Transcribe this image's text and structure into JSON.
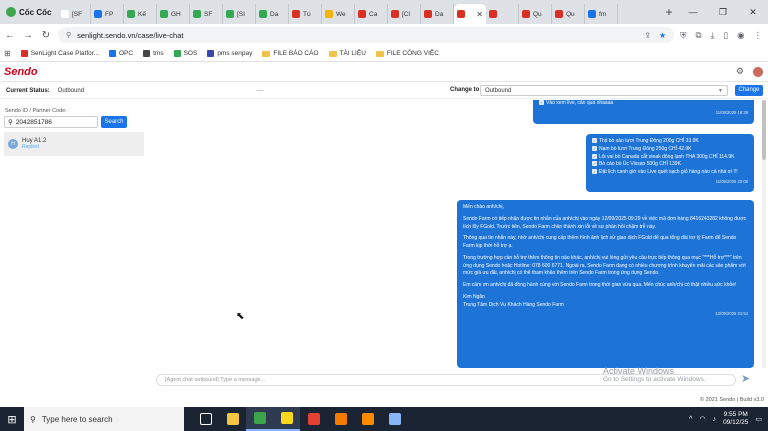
{
  "browser": {
    "brand": "Cốc Cốc",
    "tabs": [
      {
        "label": "[SF",
        "color": "#ffffff"
      },
      {
        "label": "FP",
        "color": "#1a73e8"
      },
      {
        "label": "Kế",
        "color": "#34a853"
      },
      {
        "label": "GH",
        "color": "#34a853"
      },
      {
        "label": "SF",
        "color": "#34a853"
      },
      {
        "label": "[SI",
        "color": "#34a853"
      },
      {
        "label": "Da",
        "color": "#34a853"
      },
      {
        "label": "Tú",
        "color": "#d93025"
      },
      {
        "label": "We",
        "color": "#f4b400"
      },
      {
        "label": "Ca",
        "color": "#d93025"
      },
      {
        "label": "[Cl",
        "color": "#d93025"
      },
      {
        "label": "Da",
        "color": "#d93025"
      },
      {
        "label": "",
        "color": "#d93025"
      },
      {
        "label": "",
        "color": "#d93025"
      },
      {
        "label": "Qu",
        "color": "#d93025"
      },
      {
        "label": "Qu",
        "color": "#d93025"
      },
      {
        "label": "fm",
        "color": "#1a73e8"
      }
    ],
    "url": "senlight.sendo.vn/case/live-chat",
    "bookmarks": [
      {
        "label": "SenLight Case Platfor...",
        "color": "#d93025",
        "folder": false
      },
      {
        "label": "OPC",
        "color": "#1a73e8",
        "folder": false
      },
      {
        "label": "tms",
        "color": "#444444",
        "folder": false
      },
      {
        "label": "SOS",
        "color": "#34a853",
        "folder": false
      },
      {
        "label": "pms senpay",
        "color": "#3949ab",
        "folder": false
      },
      {
        "label": "FILE BÁO CÁO",
        "color": "#f0c14b",
        "folder": true
      },
      {
        "label": "TÀI LIỆU",
        "color": "#f0c14b",
        "folder": true
      },
      {
        "label": "FILE CÔNG VIỆC",
        "color": "#f0c14b",
        "folder": true
      }
    ]
  },
  "app": {
    "logo": "Sendo",
    "status_label": "Current Status:",
    "status_value": "Outbound",
    "dots": "....",
    "change_to_label": "Change to",
    "change_to_value": "Outbound",
    "change_button": "Change"
  },
  "left": {
    "id_label": "Sendo ID / Partner Code:",
    "search_value": "2042851786",
    "search_button": "Search",
    "contact": {
      "initial": "H",
      "name": "Huy A1.2",
      "sub": "Replied"
    }
  },
  "messages": {
    "m1": {
      "lines": [
        "Vào xem live, cần quá nhaaaa"
      ],
      "time": "11/09/2025 16:39"
    },
    "m2": {
      "lines": [
        "Thịt bò xào tươi Trung Đông 200g CHỈ 33.9K",
        "Nạm bò tươi Trung Đông 250g CHỈ 42.9K",
        "Lõi vai bò Canada cắt steak đông lạnh THA 300g CHỈ 114.9K",
        "Bò cáo bò Úc Vissan 500g CHỈ 139K",
        "Đặt lịch canh giờ vào Live quét sạch giỏ hàng nào cả nhà ơi !!!"
      ],
      "time": "11/09/2025 20:08"
    },
    "m3": {
      "paragraphs": [
        "Mến chào anh/chị,",
        "Sendo Farm có tiếp nhận được tin nhắn của anh/chị vào ngày 12/09/2025 09:29 về việc mã đơn hàng 8416243282 không được tích lũy FGold. Trước tiên, Sendo Farm chân thành xin lỗi về sự phản hồi chậm trễ này.",
        "Thông qua tin nhắn này, nhờ anh/chị cung cấp thêm hình ảnh lịch sử giao dịch FGold để qua tổng đài trợ lý Farm để Sendo Farm kịp thời hỗ trợ ạ.",
        "Trong trường hợp cần hỗ trợ thêm thông tin nào khác, anh/chị vui lòng gửi yêu cầu trực tiếp thông qua mục \"***Hỗ trợ***\" trên ứng dụng Sendo hoặc Hotline: 078 600 6771. Ngoài ra, Sendo Farm đang có nhiều chương trình khuyến mãi các sản phẩm với mức giá ưu đãi, anh/chị có thể tham khảo thêm trên Sendo Farm trong ứng dụng Sendo.",
        "Em cảm ơn anh/chị đã đồng hành cùng với Sendo Farm trong thời gian vừa qua. Mến chúc anh/chị có thật nhiều sức khỏe!"
      ],
      "signature": [
        "Kim Ngân",
        "Trung Tâm Dịch Vụ Khách Hàng Sendo Farm"
      ],
      "time": "12/09/2025 21:54"
    }
  },
  "input": {
    "placeholder": "[Agent chat outbound] Type a message..."
  },
  "watermark": {
    "line1": "Activate Windows",
    "line2": "Go to Settings to activate Windows."
  },
  "footer": "© 2021 Sendo | Build v3.0",
  "taskbar": {
    "search_placeholder": "Type here to search",
    "apps": [
      {
        "name": "task-view",
        "color": "#ffffff"
      },
      {
        "name": "file-explorer",
        "color": "#f4c542"
      },
      {
        "name": "coccoc",
        "color": "#3ca44a"
      },
      {
        "name": "sticky-notes",
        "color": "#f9d71c"
      },
      {
        "name": "chrome",
        "color": "#e34133"
      },
      {
        "name": "app-orange",
        "color": "#f57c00"
      },
      {
        "name": "vlc",
        "color": "#ff8c00"
      },
      {
        "name": "notepad",
        "color": "#8ab4f8"
      }
    ],
    "time": "9:55 PM",
    "date": "09/12/25"
  }
}
